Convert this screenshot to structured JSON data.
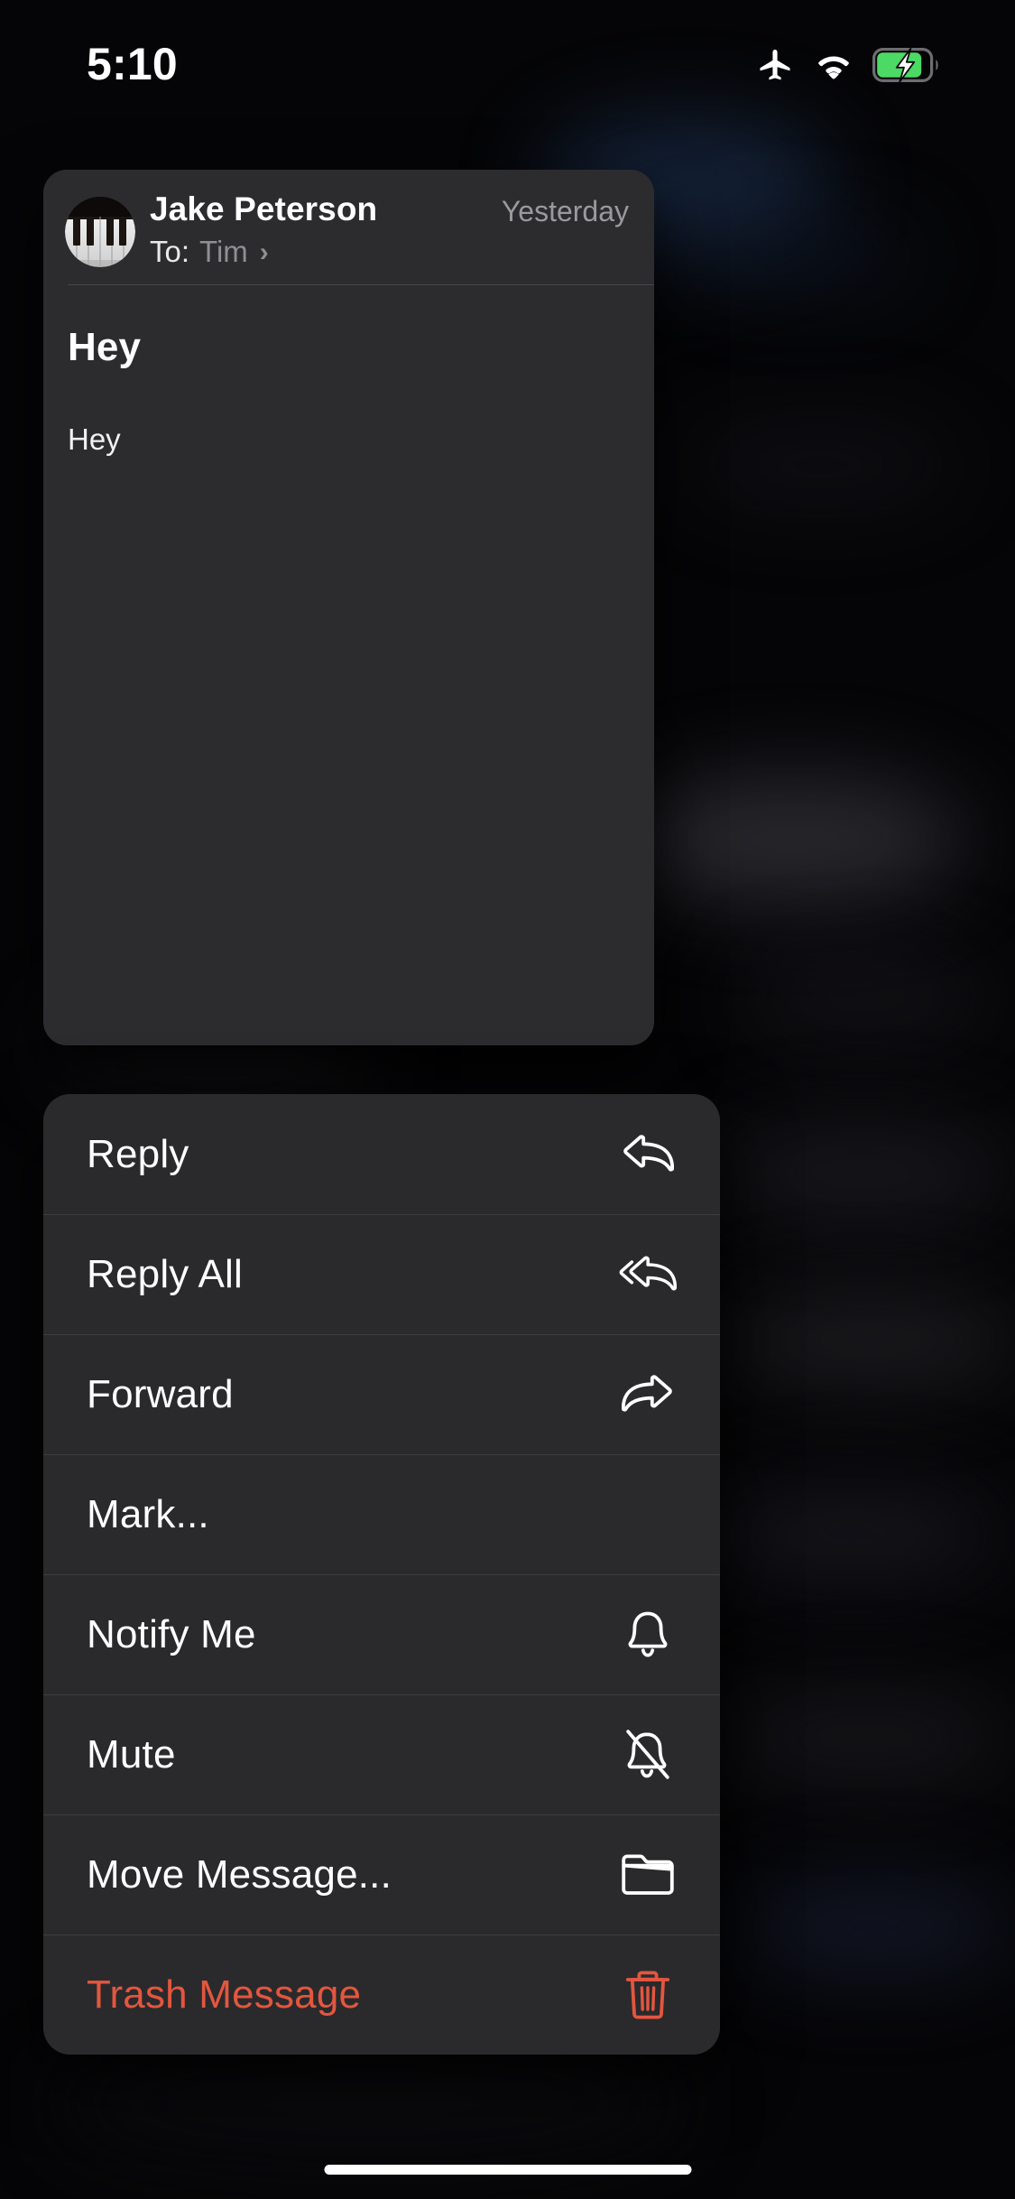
{
  "status_bar": {
    "time": "5:10",
    "icons": [
      "airplane-mode-icon",
      "wifi-icon",
      "battery-charging-icon"
    ],
    "battery_charging": true,
    "battery_color": "#4cd964"
  },
  "message_card": {
    "avatar": "piano-keys-avatar",
    "sender": "Jake Peterson",
    "to_label": "To:",
    "recipient": "Tim",
    "chevron": "›",
    "date": "Yesterday",
    "subject": "Hey",
    "body": "Hey"
  },
  "context_menu": {
    "items": [
      {
        "label": "Reply",
        "icon": "reply-icon",
        "destructive": false
      },
      {
        "label": "Reply All",
        "icon": "reply-all-icon",
        "destructive": false
      },
      {
        "label": "Forward",
        "icon": "forward-icon",
        "destructive": false
      },
      {
        "label": "Mark...",
        "icon": "",
        "destructive": false
      },
      {
        "label": "Notify Me",
        "icon": "bell-icon",
        "destructive": false
      },
      {
        "label": "Mute",
        "icon": "bell-slash-icon",
        "destructive": false
      },
      {
        "label": "Move Message...",
        "icon": "folder-icon",
        "destructive": false
      },
      {
        "label": "Trash Message",
        "icon": "trash-icon",
        "destructive": true
      }
    ]
  },
  "home_indicator": "home-indicator",
  "colors": {
    "background": "#000000",
    "card": "#2c2c2e",
    "menu_row": "#2a2a2c",
    "separator": "#3d3d40",
    "text_primary": "#ffffff",
    "text_secondary": "#8e8e93",
    "destructive": "#e4563f"
  }
}
